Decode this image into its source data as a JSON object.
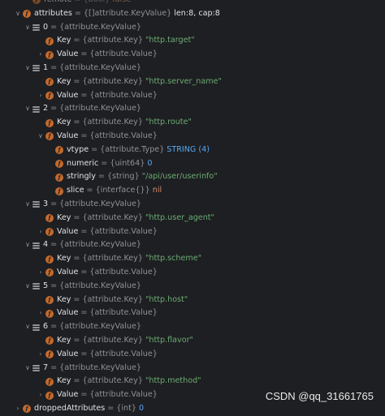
{
  "rows": [
    {
      "indent": 28,
      "chev": "none",
      "icon": "f",
      "name": "remote",
      "type": "{bool}",
      "val": "false",
      "valClass": "kw",
      "dim": true
    },
    {
      "indent": 16,
      "chev": "down",
      "icon": "f",
      "name": "attributes",
      "type": "{[]attribute.KeyValue}",
      "val": "len:8, cap:8",
      "valClass": "plain"
    },
    {
      "indent": 28,
      "chev": "down",
      "icon": "list",
      "name": "0",
      "type": "{attribute.KeyValue}"
    },
    {
      "indent": 44,
      "chev": "none",
      "icon": "f",
      "name": "Key",
      "type": "{attribute.Key}",
      "val": "\"http.target\"",
      "valClass": "str"
    },
    {
      "indent": 44,
      "chev": "right",
      "icon": "f",
      "name": "Value",
      "type": "{attribute.Value}"
    },
    {
      "indent": 28,
      "chev": "down",
      "icon": "list",
      "name": "1",
      "type": "{attribute.KeyValue}"
    },
    {
      "indent": 44,
      "chev": "none",
      "icon": "f",
      "name": "Key",
      "type": "{attribute.Key}",
      "val": "\"http.server_name\"",
      "valClass": "str"
    },
    {
      "indent": 44,
      "chev": "right",
      "icon": "f",
      "name": "Value",
      "type": "{attribute.Value}"
    },
    {
      "indent": 28,
      "chev": "down",
      "icon": "list",
      "name": "2",
      "type": "{attribute.KeyValue}"
    },
    {
      "indent": 44,
      "chev": "none",
      "icon": "f",
      "name": "Key",
      "type": "{attribute.Key}",
      "val": "\"http.route\"",
      "valClass": "str"
    },
    {
      "indent": 44,
      "chev": "down",
      "icon": "f",
      "name": "Value",
      "type": "{attribute.Value}"
    },
    {
      "indent": 56,
      "chev": "none",
      "icon": "f",
      "name": "vtype",
      "type": "{attribute.Type}",
      "val": "STRING (4)",
      "valClass": "num"
    },
    {
      "indent": 56,
      "chev": "none",
      "icon": "f",
      "name": "numeric",
      "type": "{uint64}",
      "val": "0",
      "valClass": "num"
    },
    {
      "indent": 56,
      "chev": "none",
      "icon": "f",
      "name": "stringly",
      "type": "{string}",
      "val": "\"/api/user/userinfo\"",
      "valClass": "str"
    },
    {
      "indent": 56,
      "chev": "none",
      "icon": "f",
      "name": "slice",
      "type": "{interface{}}",
      "val": "nil",
      "valClass": "kw"
    },
    {
      "indent": 28,
      "chev": "down",
      "icon": "list",
      "name": "3",
      "type": "{attribute.KeyValue}"
    },
    {
      "indent": 44,
      "chev": "none",
      "icon": "f",
      "name": "Key",
      "type": "{attribute.Key}",
      "val": "\"http.user_agent\"",
      "valClass": "str"
    },
    {
      "indent": 44,
      "chev": "right",
      "icon": "f",
      "name": "Value",
      "type": "{attribute.Value}"
    },
    {
      "indent": 28,
      "chev": "down",
      "icon": "list",
      "name": "4",
      "type": "{attribute.KeyValue}"
    },
    {
      "indent": 44,
      "chev": "none",
      "icon": "f",
      "name": "Key",
      "type": "{attribute.Key}",
      "val": "\"http.scheme\"",
      "valClass": "str"
    },
    {
      "indent": 44,
      "chev": "right",
      "icon": "f",
      "name": "Value",
      "type": "{attribute.Value}"
    },
    {
      "indent": 28,
      "chev": "down",
      "icon": "list",
      "name": "5",
      "type": "{attribute.KeyValue}"
    },
    {
      "indent": 44,
      "chev": "none",
      "icon": "f",
      "name": "Key",
      "type": "{attribute.Key}",
      "val": "\"http.host\"",
      "valClass": "str"
    },
    {
      "indent": 44,
      "chev": "right",
      "icon": "f",
      "name": "Value",
      "type": "{attribute.Value}"
    },
    {
      "indent": 28,
      "chev": "down",
      "icon": "list",
      "name": "6",
      "type": "{attribute.KeyValue}"
    },
    {
      "indent": 44,
      "chev": "none",
      "icon": "f",
      "name": "Key",
      "type": "{attribute.Key}",
      "val": "\"http.flavor\"",
      "valClass": "str"
    },
    {
      "indent": 44,
      "chev": "right",
      "icon": "f",
      "name": "Value",
      "type": "{attribute.Value}"
    },
    {
      "indent": 28,
      "chev": "down",
      "icon": "list",
      "name": "7",
      "type": "{attribute.KeyValue}"
    },
    {
      "indent": 44,
      "chev": "none",
      "icon": "f",
      "name": "Key",
      "type": "{attribute.Key}",
      "val": "\"http.method\"",
      "valClass": "str"
    },
    {
      "indent": 44,
      "chev": "right",
      "icon": "f",
      "name": "Value",
      "type": "{attribute.Value}"
    },
    {
      "indent": 16,
      "chev": "right",
      "icon": "f",
      "name": "droppedAttributes",
      "type": "{int}",
      "val": "0",
      "valClass": "num"
    }
  ],
  "watermark": "CSDN @qq_31661765",
  "colors": {
    "background": "#1e1f22",
    "field_icon": "#c46a2c",
    "string": "#6aab73",
    "number": "#56a8f5",
    "keyword": "#cf8e6d"
  }
}
